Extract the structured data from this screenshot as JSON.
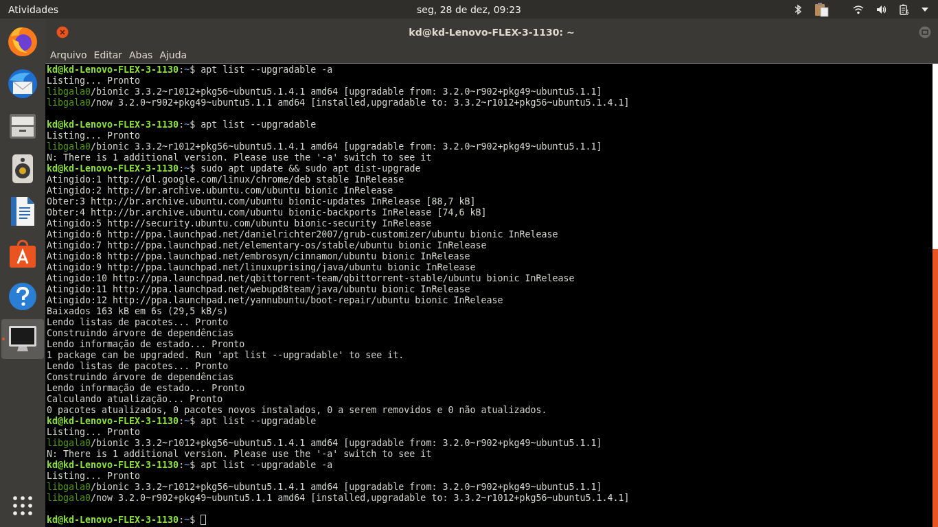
{
  "top_bar": {
    "activities": "Atividades",
    "clock": "seg, 28 de dez, 09:23"
  },
  "dock": {
    "items": [
      {
        "kind": "browser",
        "running": false,
        "selected": false
      },
      {
        "kind": "mail",
        "running": false,
        "selected": false
      },
      {
        "kind": "files",
        "running": false,
        "selected": false
      },
      {
        "kind": "music",
        "running": false,
        "selected": false
      },
      {
        "kind": "writer",
        "running": false,
        "selected": false
      },
      {
        "kind": "store",
        "running": false,
        "selected": false
      },
      {
        "kind": "help",
        "running": false,
        "selected": false
      },
      {
        "kind": "terminal",
        "running": true,
        "selected": true
      }
    ]
  },
  "window": {
    "title": "kd@kd-Lenovo-FLEX-3-1130: ~",
    "menu": [
      "Arquivo",
      "Editar",
      "Abas",
      "Ajuda"
    ]
  },
  "terminal": {
    "lines": [
      {
        "kind": "prompt",
        "user_host": "kd@kd-Lenovo-FLEX-3-1130",
        "colon": ":",
        "path": "~",
        "symbol": "$",
        "command": "apt list --upgradable -a",
        "cursor": false
      },
      {
        "kind": "output",
        "text": "Listing... Pronto"
      },
      {
        "kind": "package",
        "name": "libgala0",
        "text": "/bionic 3.3.2~r1012+pkg56~ubuntu5.1.4.1 amd64 [upgradable from: 3.2.0~r902+pkg49~ubuntu5.1.1]"
      },
      {
        "kind": "package",
        "name": "libgala0",
        "text": "/now 3.2.0~r902+pkg49~ubuntu5.1.1 amd64 [installed,upgradable to: 3.3.2~r1012+pkg56~ubuntu5.1.4.1]"
      },
      {
        "kind": "blank"
      },
      {
        "kind": "prompt",
        "user_host": "kd@kd-Lenovo-FLEX-3-1130",
        "colon": ":",
        "path": "~",
        "symbol": "$",
        "command": "apt list --upgradable",
        "cursor": false
      },
      {
        "kind": "output",
        "text": "Listing... Pronto"
      },
      {
        "kind": "package",
        "name": "libgala0",
        "text": "/bionic 3.3.2~r1012+pkg56~ubuntu5.1.4.1 amd64 [upgradable from: 3.2.0~r902+pkg49~ubuntu5.1.1]"
      },
      {
        "kind": "output",
        "text": "N: There is 1 additional version. Please use the '-a' switch to see it"
      },
      {
        "kind": "prompt",
        "user_host": "kd@kd-Lenovo-FLEX-3-1130",
        "colon": ":",
        "path": "~",
        "symbol": "$",
        "command": "sudo apt update && sudo apt dist-upgrade",
        "cursor": false
      },
      {
        "kind": "output",
        "text": "Atingido:1 http://dl.google.com/linux/chrome/deb stable InRelease"
      },
      {
        "kind": "output",
        "text": "Atingido:2 http://br.archive.ubuntu.com/ubuntu bionic InRelease"
      },
      {
        "kind": "output",
        "text": "Obter:3 http://br.archive.ubuntu.com/ubuntu bionic-updates InRelease [88,7 kB]"
      },
      {
        "kind": "output",
        "text": "Obter:4 http://br.archive.ubuntu.com/ubuntu bionic-backports InRelease [74,6 kB]"
      },
      {
        "kind": "output",
        "text": "Atingido:5 http://security.ubuntu.com/ubuntu bionic-security InRelease"
      },
      {
        "kind": "output",
        "text": "Atingido:6 http://ppa.launchpad.net/danielrichter2007/grub-customizer/ubuntu bionic InRelease"
      },
      {
        "kind": "output",
        "text": "Atingido:7 http://ppa.launchpad.net/elementary-os/stable/ubuntu bionic InRelease"
      },
      {
        "kind": "output",
        "text": "Atingido:8 http://ppa.launchpad.net/embrosyn/cinnamon/ubuntu bionic InRelease"
      },
      {
        "kind": "output",
        "text": "Atingido:9 http://ppa.launchpad.net/linuxuprising/java/ubuntu bionic InRelease"
      },
      {
        "kind": "output",
        "text": "Atingido:10 http://ppa.launchpad.net/qbittorrent-team/qbittorrent-stable/ubuntu bionic InRelease"
      },
      {
        "kind": "output",
        "text": "Atingido:11 http://ppa.launchpad.net/webupd8team/java/ubuntu bionic InRelease"
      },
      {
        "kind": "output",
        "text": "Atingido:12 http://ppa.launchpad.net/yannubuntu/boot-repair/ubuntu bionic InRelease"
      },
      {
        "kind": "output",
        "text": "Baixados 163 kB em 6s (29,5 kB/s)"
      },
      {
        "kind": "output",
        "text": "Lendo listas de pacotes... Pronto"
      },
      {
        "kind": "output",
        "text": "Construindo árvore de dependências"
      },
      {
        "kind": "output",
        "text": "Lendo informação de estado... Pronto"
      },
      {
        "kind": "output",
        "text": "1 package can be upgraded. Run 'apt list --upgradable' to see it."
      },
      {
        "kind": "output",
        "text": "Lendo listas de pacotes... Pronto"
      },
      {
        "kind": "output",
        "text": "Construindo árvore de dependências"
      },
      {
        "kind": "output",
        "text": "Lendo informação de estado... Pronto"
      },
      {
        "kind": "output",
        "text": "Calculando atualização... Pronto"
      },
      {
        "kind": "output",
        "text": "0 pacotes atualizados, 0 pacotes novos instalados, 0 a serem removidos e 0 não atualizados."
      },
      {
        "kind": "prompt",
        "user_host": "kd@kd-Lenovo-FLEX-3-1130",
        "colon": ":",
        "path": "~",
        "symbol": "$",
        "command": "apt list --upgradable",
        "cursor": false
      },
      {
        "kind": "output",
        "text": "Listing... Pronto"
      },
      {
        "kind": "package",
        "name": "libgala0",
        "text": "/bionic 3.3.2~r1012+pkg56~ubuntu5.1.4.1 amd64 [upgradable from: 3.2.0~r902+pkg49~ubuntu5.1.1]"
      },
      {
        "kind": "output",
        "text": "N: There is 1 additional version. Please use the '-a' switch to see it"
      },
      {
        "kind": "prompt",
        "user_host": "kd@kd-Lenovo-FLEX-3-1130",
        "colon": ":",
        "path": "~",
        "symbol": "$",
        "command": "apt list --upgradable -a",
        "cursor": false
      },
      {
        "kind": "output",
        "text": "Listing... Pronto"
      },
      {
        "kind": "package",
        "name": "libgala0",
        "text": "/bionic 3.3.2~r1012+pkg56~ubuntu5.1.4.1 amd64 [upgradable from: 3.2.0~r902+pkg49~ubuntu5.1.1]"
      },
      {
        "kind": "package",
        "name": "libgala0",
        "text": "/now 3.2.0~r902+pkg49~ubuntu5.1.1 amd64 [installed,upgradable to: 3.3.2~r1012+pkg56~ubuntu5.1.4.1]"
      },
      {
        "kind": "blank"
      },
      {
        "kind": "prompt",
        "user_host": "kd@kd-Lenovo-FLEX-3-1130",
        "colon": ":",
        "path": "~",
        "symbol": "$",
        "cursor": true
      }
    ]
  }
}
